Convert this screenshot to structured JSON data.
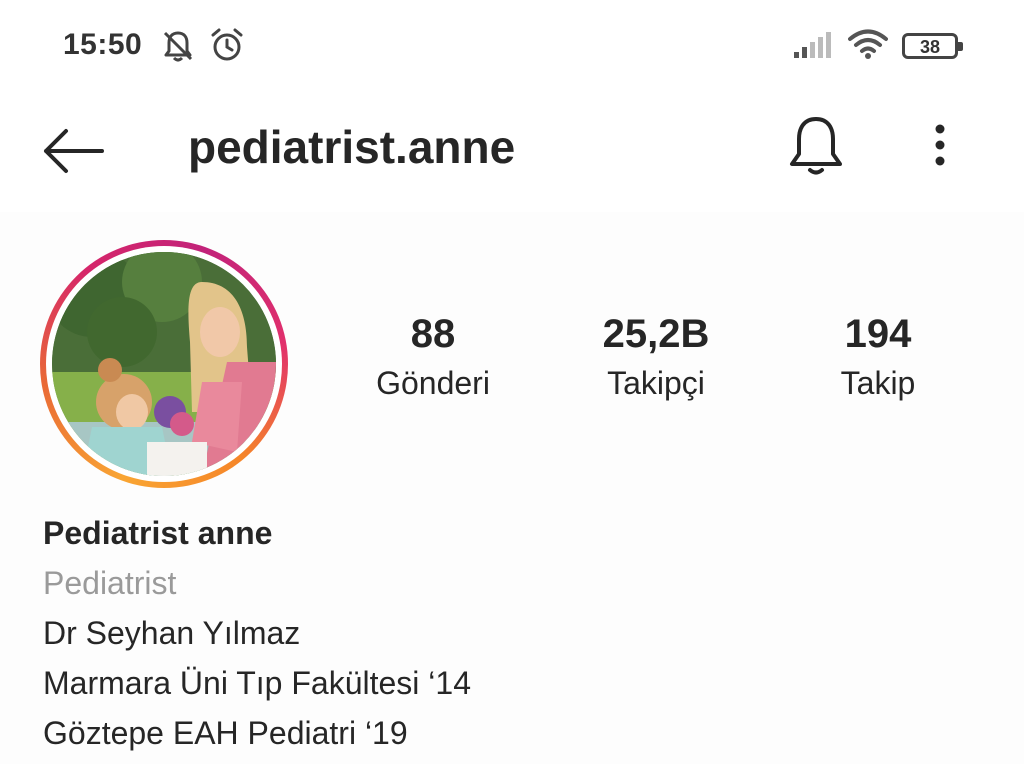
{
  "status_bar": {
    "time": "15:50",
    "battery": "38",
    "icons": [
      "notifications-off-icon",
      "alarm-icon",
      "signal-icon",
      "wifi-icon",
      "battery-icon"
    ]
  },
  "header": {
    "username": "pediatrist.anne",
    "icons": [
      "back-arrow-icon",
      "bell-icon",
      "more-vertical-icon"
    ]
  },
  "profile": {
    "stats": [
      {
        "value": "88",
        "label": "Gönderi"
      },
      {
        "value": "25,2B",
        "label": "Takipçi"
      },
      {
        "value": "194",
        "label": "Takip"
      }
    ],
    "name": "Pediatrist anne",
    "category": "Pediatrist",
    "bio_lines": [
      "Dr Seyhan Yılmaz",
      "Marmara Üni Tıp Fakültesi ‘14",
      "Göztepe EAH Pediatri ‘19"
    ],
    "story_ring_colors": [
      "#f9a533",
      "#e96a36",
      "#d6266a",
      "#c2237a"
    ]
  }
}
